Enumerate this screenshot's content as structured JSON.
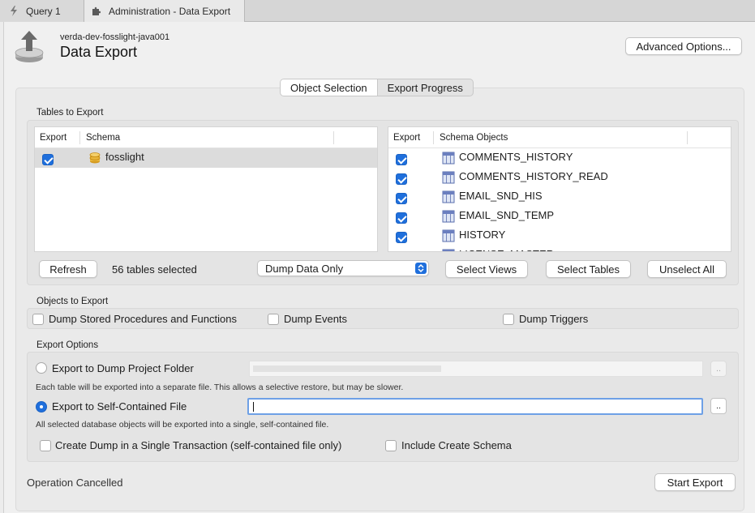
{
  "tabs": [
    {
      "label": "Query 1",
      "icon": "lightning-icon"
    },
    {
      "label": "Administration - Data Export",
      "icon": "puzzle-icon"
    }
  ],
  "header": {
    "connection": "verda-dev-fosslight-java001",
    "title": "Data Export",
    "advanced_button": "Advanced Options..."
  },
  "segments": {
    "object_selection": "Object Selection",
    "export_progress": "Export Progress",
    "active": "Object Selection"
  },
  "tables_to_export": {
    "label": "Tables to Export",
    "schema_table": {
      "headers": [
        "Export",
        "Schema"
      ],
      "rows": [
        {
          "checked": true,
          "name": "fosslight"
        }
      ]
    },
    "objects_table": {
      "headers": [
        "Export",
        "Schema Objects"
      ],
      "rows": [
        {
          "checked": true,
          "name": "COMMENTS_HISTORY"
        },
        {
          "checked": true,
          "name": "COMMENTS_HISTORY_READ"
        },
        {
          "checked": true,
          "name": "EMAIL_SND_HIS"
        },
        {
          "checked": true,
          "name": "EMAIL_SND_TEMP"
        },
        {
          "checked": true,
          "name": "HISTORY"
        },
        {
          "checked": true,
          "name": "LICENSE_MASTER"
        }
      ]
    },
    "refresh_button": "Refresh",
    "selected_count": "56 tables selected",
    "dump_mode": "Dump Data Only",
    "select_views_button": "Select Views",
    "select_tables_button": "Select Tables",
    "unselect_all_button": "Unselect All"
  },
  "objects_to_export": {
    "label": "Objects to Export",
    "options": [
      {
        "label": "Dump Stored Procedures and Functions",
        "checked": false
      },
      {
        "label": "Dump Events",
        "checked": false
      },
      {
        "label": "Dump Triggers",
        "checked": false
      }
    ]
  },
  "export_options": {
    "label": "Export Options",
    "folder_option": {
      "label": "Export to Dump Project Folder",
      "selected": false,
      "description": "Each table will be exported into a separate file. This allows a selective restore, but may be slower."
    },
    "file_option": {
      "label": "Export to Self-Contained File",
      "selected": true,
      "description": "All selected database objects will be exported into a single, self-contained file."
    },
    "browse_label": "..",
    "single_transaction": {
      "label": "Create Dump in a Single Transaction (self-contained file only)",
      "checked": false
    },
    "include_schema": {
      "label": "Include Create Schema",
      "checked": false
    }
  },
  "footer": {
    "status": "Operation Cancelled",
    "start_button": "Start Export"
  },
  "colors": {
    "accent": "#1f6fdc",
    "focus_ring": "#6ea0e6"
  }
}
